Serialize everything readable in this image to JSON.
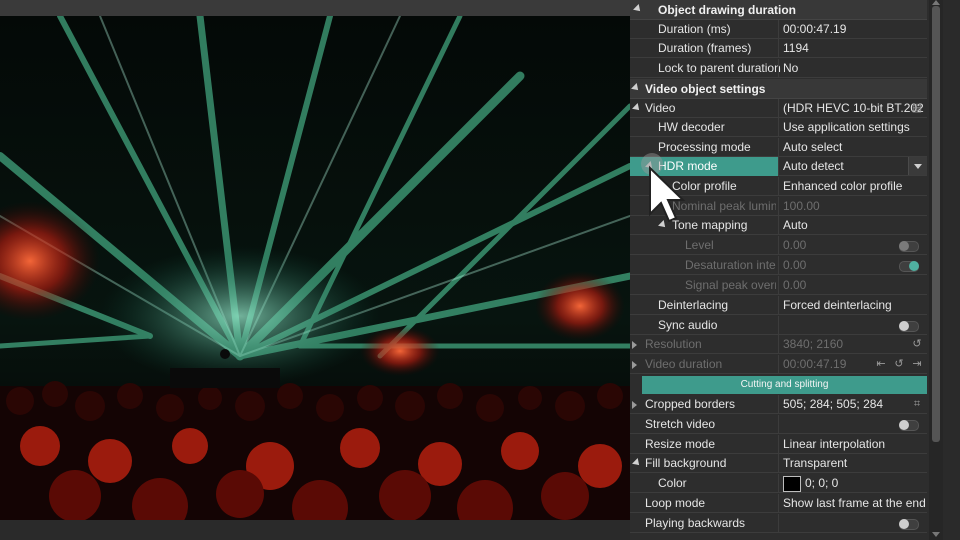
{
  "sections": {
    "drawing": "Object drawing duration",
    "video_object": "Video object settings"
  },
  "rows": {
    "duration_ms": {
      "label": "Duration (ms)",
      "value": "00:00:47.19"
    },
    "duration_frames": {
      "label": "Duration (frames)",
      "value": "1194"
    },
    "lock_parent": {
      "label": "Lock to parent duration",
      "value": "No"
    },
    "video": {
      "label": "Video",
      "value": "(HDR HEVC 10-bit BT.202"
    },
    "hw_decoder": {
      "label": "HW decoder",
      "value": "Use application settings"
    },
    "processing_mode": {
      "label": "Processing mode",
      "value": "Auto select"
    },
    "hdr_mode": {
      "label": "HDR mode",
      "value": "Auto detect"
    },
    "color_profile": {
      "label": "Color profile",
      "value": "Enhanced color profile"
    },
    "nominal_peak": {
      "label": "Nominal peak lumina",
      "value": "100.00"
    },
    "tone_mapping": {
      "label": "Tone mapping",
      "value": "Auto"
    },
    "level": {
      "label": "Level",
      "value": "0.00"
    },
    "desaturation": {
      "label": "Desaturation inten",
      "value": "0.00"
    },
    "signal_peak": {
      "label": "Signal peak overri",
      "value": "0.00"
    },
    "deinterlacing": {
      "label": "Deinterlacing",
      "value": "Forced deinterlacing"
    },
    "sync_audio": {
      "label": "Sync audio"
    },
    "resolution": {
      "label": "Resolution",
      "value": "3840; 2160"
    },
    "video_duration": {
      "label": "Video duration",
      "value": "00:00:47.19"
    },
    "cropped_borders": {
      "label": "Cropped borders",
      "value": "505; 284; 505; 284"
    },
    "stretch_video": {
      "label": "Stretch video"
    },
    "resize_mode": {
      "label": "Resize mode",
      "value": "Linear interpolation"
    },
    "fill_background": {
      "label": "Fill background",
      "value": "Transparent"
    },
    "color": {
      "label": "Color",
      "value": "0; 0; 0"
    },
    "loop_mode": {
      "label": "Loop mode",
      "value": "Show last frame at the end o"
    },
    "playing_backwards": {
      "label": "Playing backwards"
    }
  },
  "cutting_button": "Cutting and splitting",
  "colors": {
    "accent": "#3e9b8c",
    "panel": "#2d2d2d"
  }
}
